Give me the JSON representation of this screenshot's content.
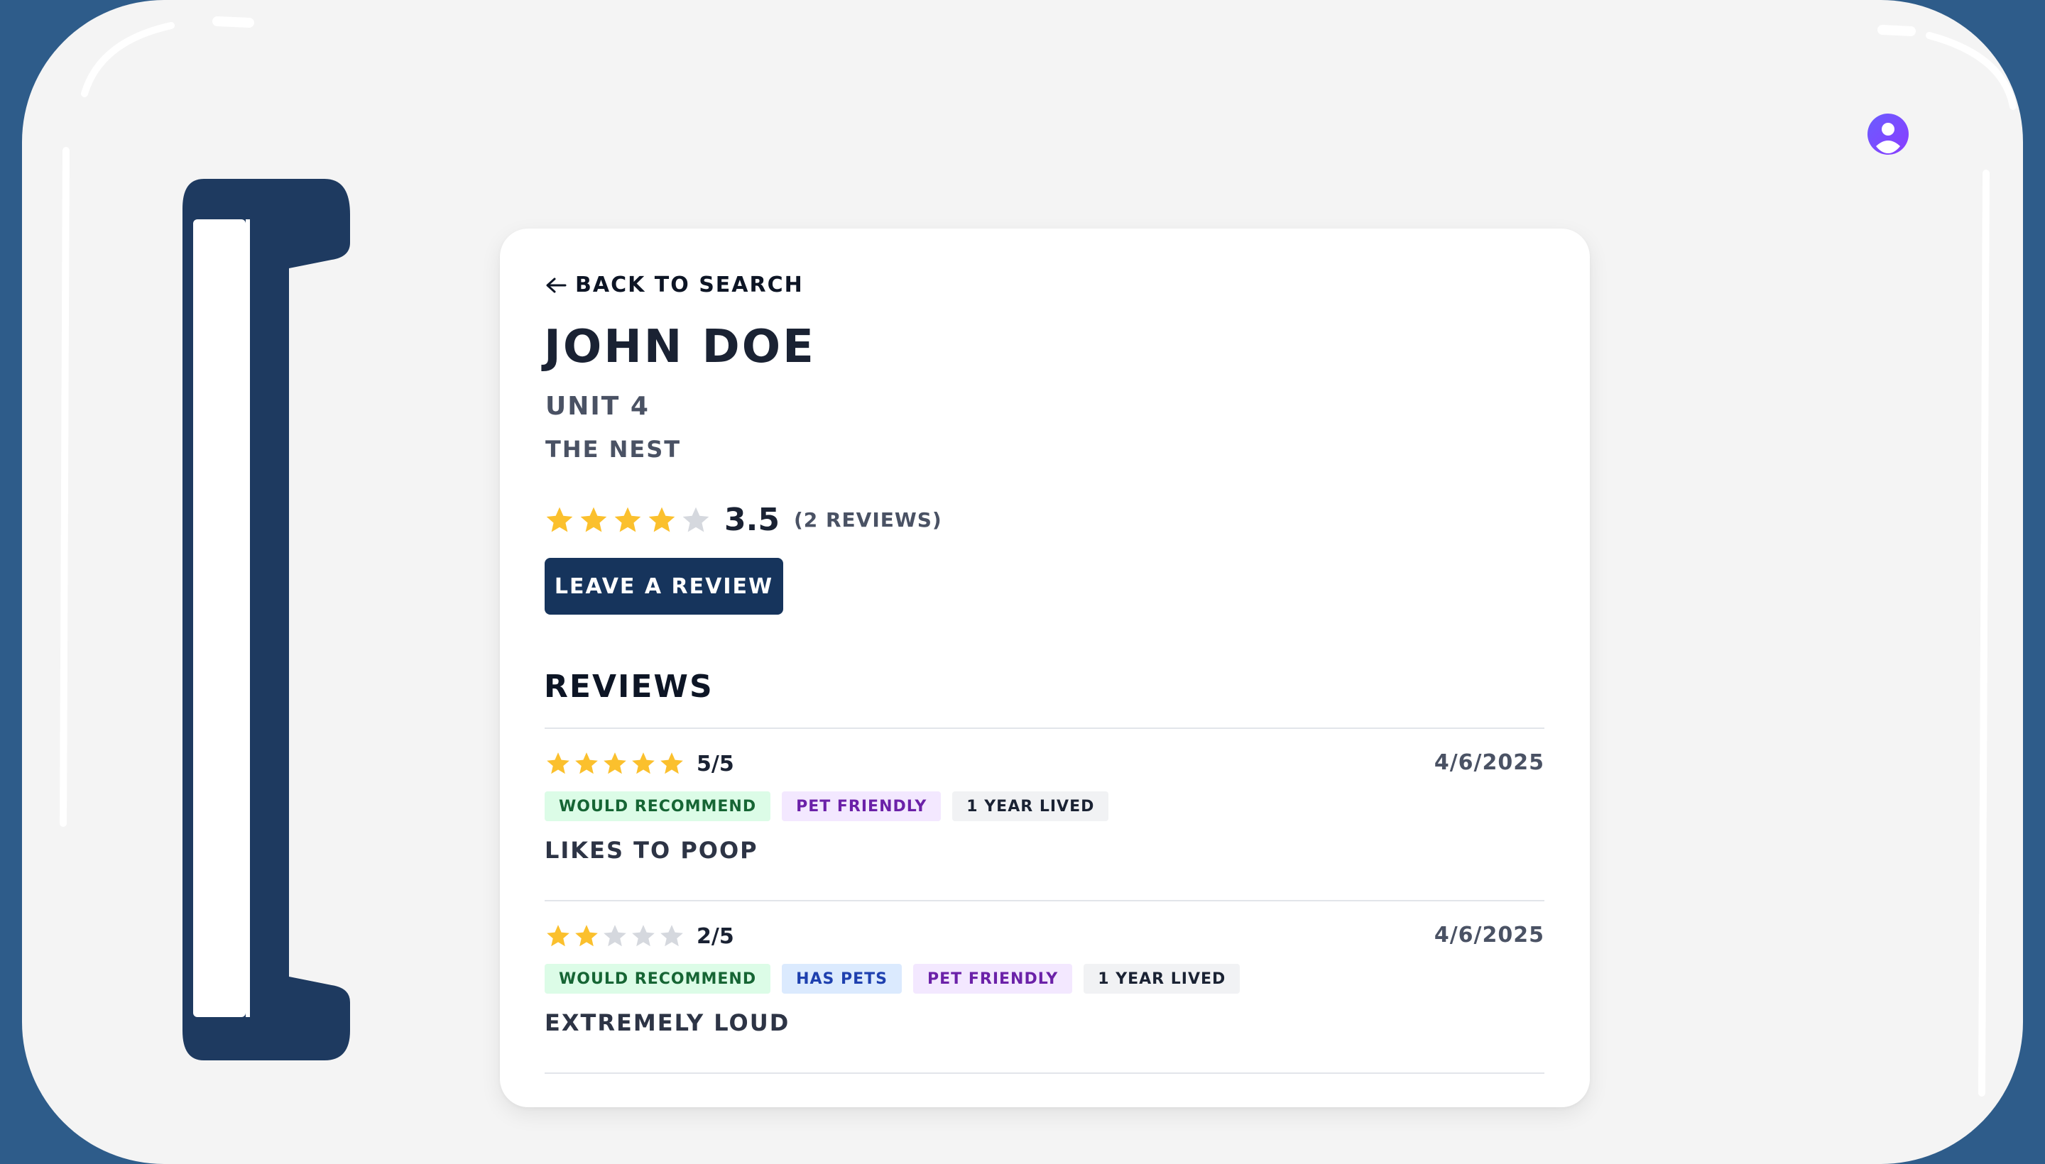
{
  "profile": {
    "back_label": "Back to search",
    "name": "John Doe",
    "unit": "Unit 4",
    "building": "The Nest",
    "rating_value": "3.5",
    "rating_count": "(2 reviews)",
    "stars": [
      1,
      1,
      1,
      1,
      0
    ],
    "leave_review_label": "Leave a review"
  },
  "reviews_heading": "Reviews",
  "reviews": [
    {
      "stars": [
        1,
        1,
        1,
        1,
        1
      ],
      "score": "5/5",
      "date": "4/6/2025",
      "tags": [
        {
          "label": "Would recommend",
          "color": "green"
        },
        {
          "label": "Pet friendly",
          "color": "purple"
        },
        {
          "label": "1 year lived",
          "color": "gray"
        }
      ],
      "text": "Likes to poop"
    },
    {
      "stars": [
        1,
        1,
        0,
        0,
        0
      ],
      "score": "2/5",
      "date": "4/6/2025",
      "tags": [
        {
          "label": "Would recommend",
          "color": "green"
        },
        {
          "label": "Has pets",
          "color": "blue"
        },
        {
          "label": "Pet friendly",
          "color": "purple"
        },
        {
          "label": "1 year lived",
          "color": "gray"
        }
      ],
      "text": "Extremely loud"
    }
  ],
  "colors": {
    "star_filled": "#fbc02d",
    "star_empty": "#d5d8de",
    "primary": "#16345c",
    "frame": "#2e5c8a",
    "avatar": "#7b4dff"
  },
  "icons": {
    "back": "arrow-left-icon",
    "profile": "user-avatar-icon",
    "star": "star-icon",
    "logo": "bracket-logo"
  }
}
